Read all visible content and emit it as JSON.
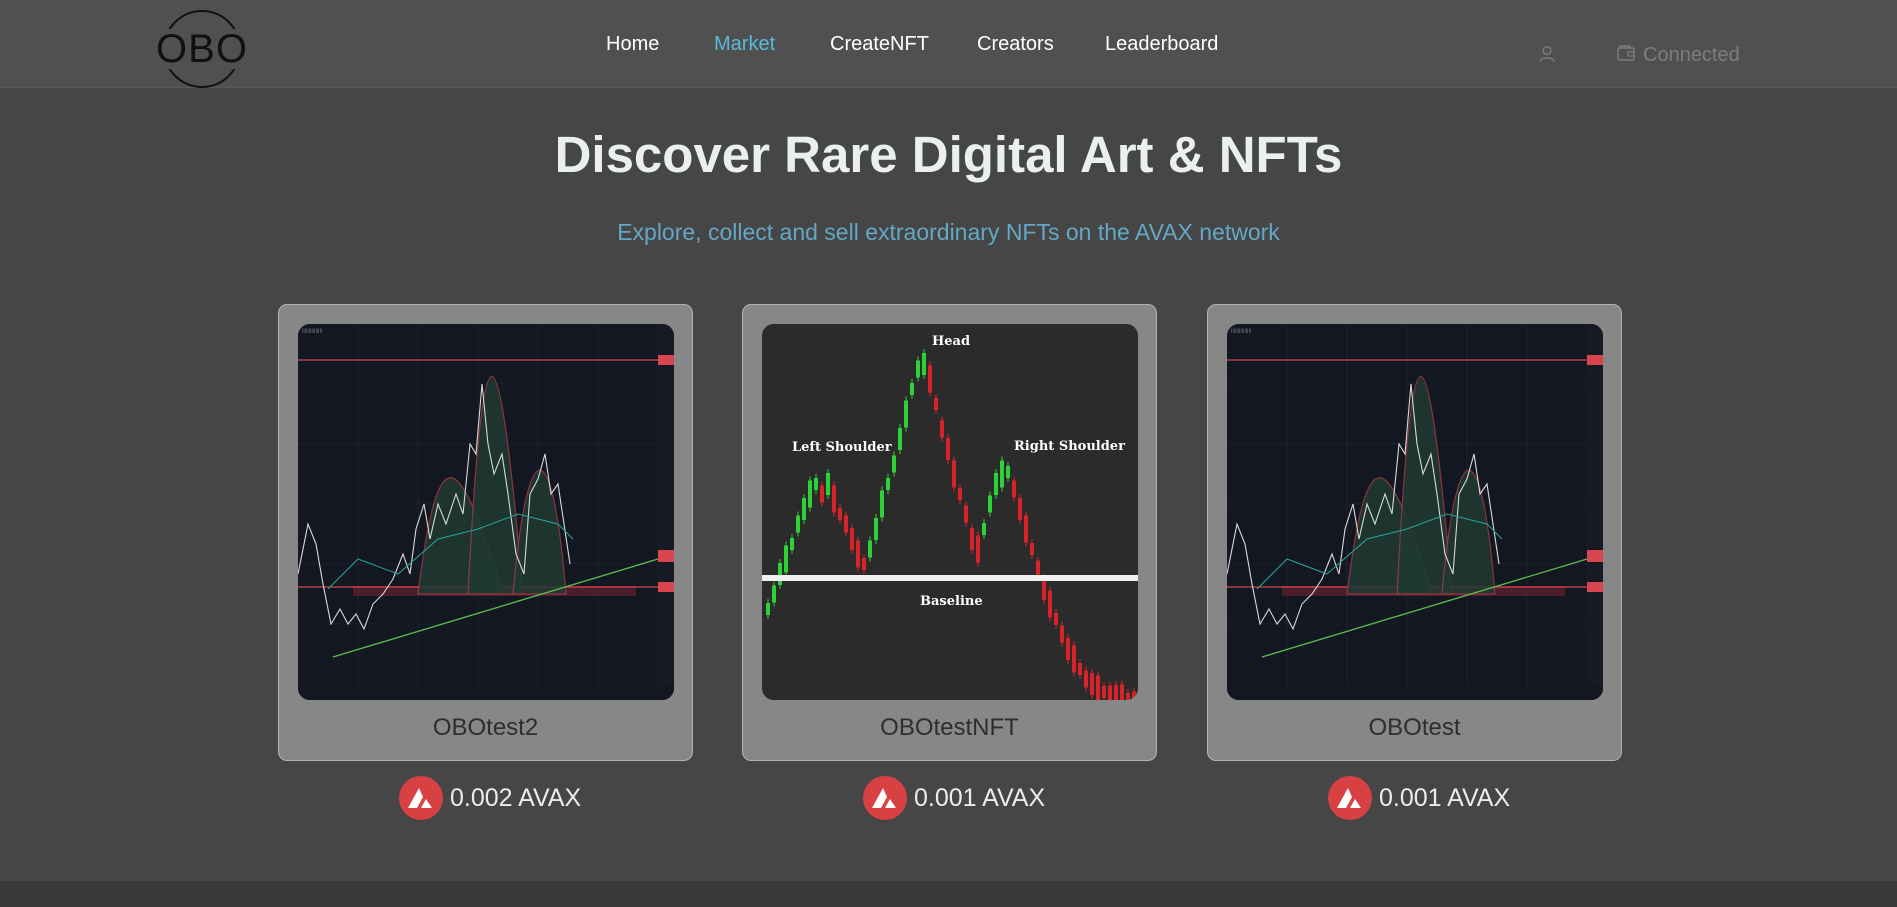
{
  "header": {
    "logo_text": "OBO",
    "nav": [
      {
        "label": "Home",
        "active": false
      },
      {
        "label": "Market",
        "active": true
      },
      {
        "label": "CreateNFT",
        "active": false
      },
      {
        "label": "Creators",
        "active": false
      },
      {
        "label": "Leaderboard",
        "active": false
      }
    ],
    "user_icon": "user-icon",
    "wallet_icon": "wallet-icon",
    "wallet_status": "Connected"
  },
  "hero": {
    "title": "Discover Rare Digital Art & NFTs",
    "subtitle": "Explore, collect and sell extraordinary NFTs on the AVAX network"
  },
  "nfts": [
    {
      "name": "OBOtest2",
      "price": "0.002 AVAX",
      "image": "trading-chart"
    },
    {
      "name": "OBOtestNFT",
      "price": "0.001 AVAX",
      "image": "head-and-shoulders-pattern",
      "image_labels": {
        "head": "Head",
        "left": "Left Shoulder",
        "right": "Right Shoulder",
        "base": "Baseline"
      }
    },
    {
      "name": "OBOtest",
      "price": "0.001 AVAX",
      "image": "trading-chart"
    }
  ],
  "colors": {
    "accent": "#58b9dc",
    "subtitle": "#64a8c6",
    "avax": "#d84143",
    "background": "#464646",
    "card": "#878787"
  }
}
